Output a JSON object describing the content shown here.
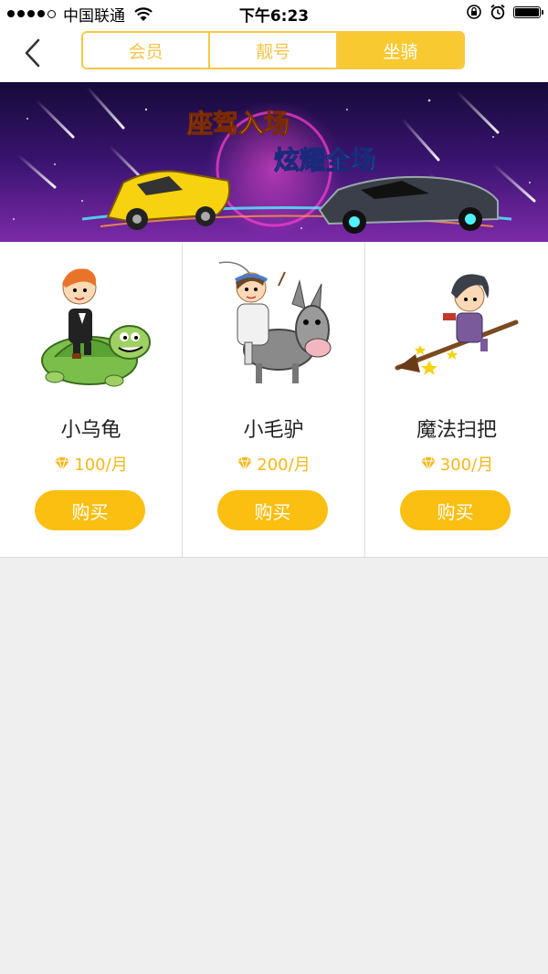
{
  "status_bar": {
    "carrier": "中国联通",
    "time": "下午6:23",
    "signal_icon": "signal-dots-icon",
    "wifi_icon": "wifi-icon",
    "lock_icon": "orientation-lock-icon",
    "alarm_icon": "alarm-icon",
    "battery_icon": "battery-icon",
    "battery_level": 1.0
  },
  "nav": {
    "back_icon": "chevron-left-icon",
    "tabs": [
      {
        "label": "会员",
        "active": false
      },
      {
        "label": "靓号",
        "active": false
      },
      {
        "label": "坐骑",
        "active": true
      }
    ]
  },
  "banner": {
    "line1": "座驾入场",
    "line2": "炫耀全场"
  },
  "items": [
    {
      "name": "小乌龟",
      "price": "100/月",
      "buy_label": "购买",
      "icon": "turtle-rider-icon"
    },
    {
      "name": "小毛驴",
      "price": "200/月",
      "buy_label": "购买",
      "icon": "donkey-rider-icon"
    },
    {
      "name": "魔法扫把",
      "price": "300/月",
      "buy_label": "购买",
      "icon": "broom-rider-icon"
    }
  ],
  "colors": {
    "accent": "#f9c932",
    "button": "#fbbf12",
    "price": "#f4b81a",
    "background": "#efefef"
  }
}
